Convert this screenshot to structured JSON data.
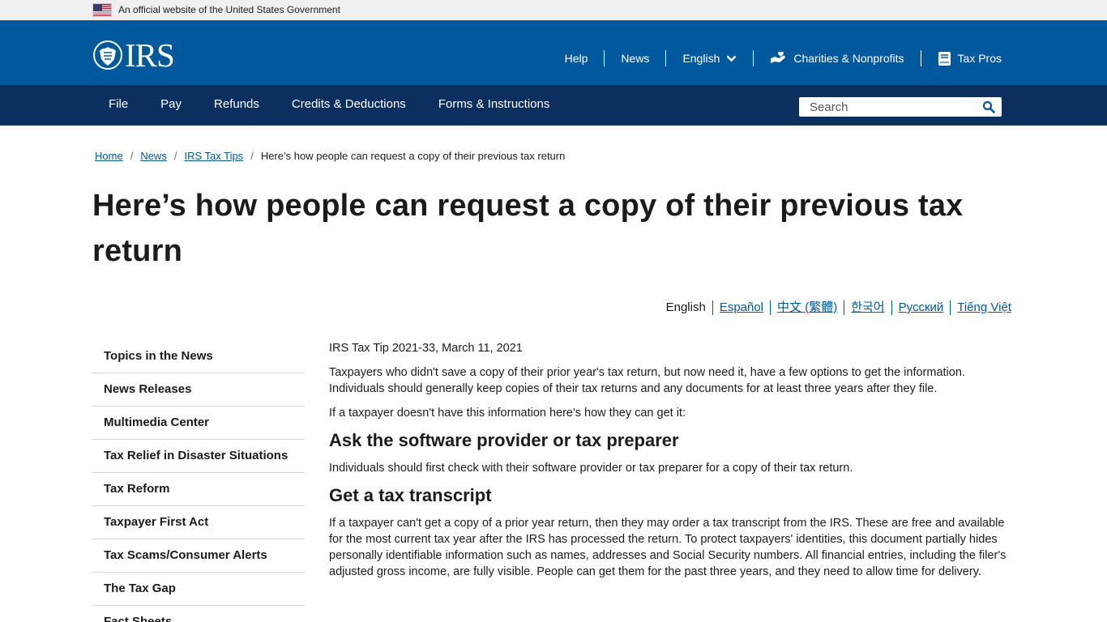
{
  "gov_banner": {
    "text": "An official website of the United States Government"
  },
  "header": {
    "logo_text": "IRS",
    "util_nav": [
      {
        "label": "Help"
      },
      {
        "label": "News"
      },
      {
        "label": "English"
      },
      {
        "label": "Charities & Nonprofits"
      },
      {
        "label": "Tax Pros"
      }
    ]
  },
  "main_nav": {
    "items": [
      "File",
      "Pay",
      "Refunds",
      "Credits & Deductions",
      "Forms & Instructions"
    ],
    "search_placeholder": "Search"
  },
  "breadcrumb": {
    "items": [
      "Home",
      "News",
      "IRS Tax Tips"
    ],
    "current": "Here’s how people can request a copy of their previous tax return"
  },
  "page_title": "Here’s how people can request a copy of their previous tax return",
  "languages": {
    "current": "English",
    "links": [
      "Español",
      "中文 (繁體)",
      "한국어",
      "Русский",
      "Tiếng Việt"
    ]
  },
  "sidebar": {
    "items": [
      "Topics in the News",
      "News Releases",
      "Multimedia Center",
      "Tax Relief in Disaster Situations",
      "Tax Reform",
      "Taxpayer First Act",
      "Tax Scams/Consumer Alerts",
      "The Tax Gap",
      "Fact Sheets"
    ]
  },
  "article": {
    "dateline": "IRS Tax Tip 2021-33, March 11, 2021",
    "intro": "Taxpayers who didn't save a copy of their prior year's tax return, but now need it, have a few options to get the information. Individuals should generally keep copies of their tax returns and any documents for at least three years after they file.",
    "lead": "If a taxpayer doesn't have this information here's how they can get it:",
    "section1_heading": "Ask the software provider or tax preparer",
    "section1_text": "Individuals should first check with their software provider or tax preparer for a copy of their tax return.",
    "section2_heading": "Get a tax transcript",
    "section2_text": "If a taxpayer can't get a copy of a prior year return, then they may order a tax transcript from the IRS. These are free and available for the most current tax year after the IRS has processed the return. To protect taxpayers' identities, this document partially hides personally identifiable information such as names, addresses and Social Security numbers. All financial entries, including the filer's adjusted gross income, are fully visible. People can get them for the past three years, and they need to allow time for delivery."
  },
  "colors": {
    "header_blue": "#00599c",
    "nav_navy": "#0b2f5e",
    "link_blue": "#00599c",
    "banner_gray": "#f0f0f0"
  },
  "icons": [
    "us-flag-icon",
    "irs-eagle-seal-icon",
    "chevron-down-icon",
    "charity-hand-icon",
    "tax-pros-book-icon",
    "search-icon"
  ]
}
